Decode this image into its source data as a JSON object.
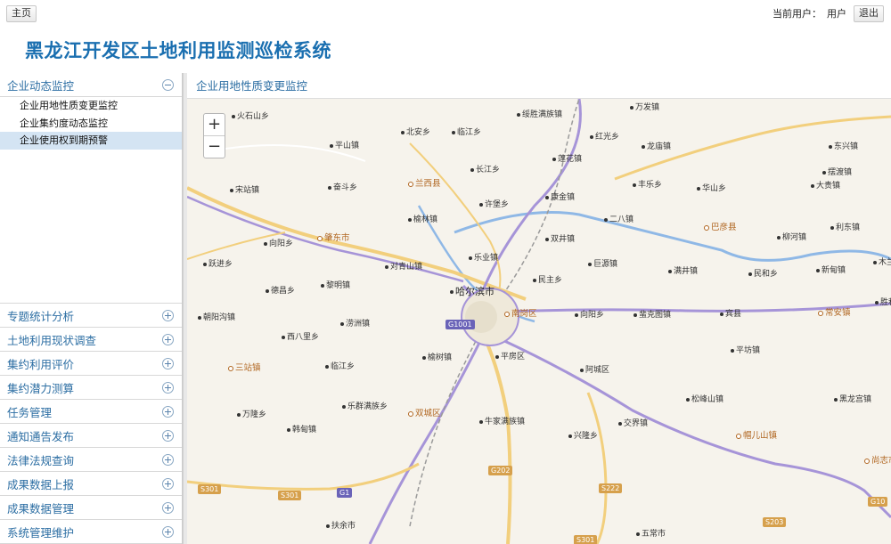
{
  "header": {
    "home_label": "主页",
    "current_user_label": "当前用户：",
    "user_name": "用户",
    "logout_label": "退出"
  },
  "app_title": "黑龙江开发区土地利用监测巡检系统",
  "sidebar": {
    "open_section": {
      "label": "企业动态监控",
      "items": [
        {
          "label": "企业用地性质变更监控"
        },
        {
          "label": "企业集约度动态监控"
        },
        {
          "label": "企业使用权到期预警"
        }
      ]
    },
    "sections": [
      {
        "label": "专题统计分析"
      },
      {
        "label": "土地利用现状调查"
      },
      {
        "label": "集约利用评价"
      },
      {
        "label": "集约潜力测算"
      },
      {
        "label": "任务管理"
      },
      {
        "label": "通知通告发布"
      },
      {
        "label": "法律法规查询"
      },
      {
        "label": "成果数据上报"
      },
      {
        "label": "成果数据管理"
      },
      {
        "label": "系统管理维护"
      }
    ]
  },
  "panel": {
    "title": "企业用地性质变更监控"
  },
  "map": {
    "zoom_in": "+",
    "zoom_out": "−",
    "places": [
      "火石山乡",
      "北安乡",
      "临江乡",
      "绥胜满族镇",
      "万发镇",
      "平山镇",
      "红光乡",
      "龙庙镇",
      "东兴镇",
      "莲花镇",
      "长江乡",
      "兰西县",
      "丰乐乡",
      "摆渡镇",
      "宋站镇",
      "奋斗乡",
      "康金镇",
      "华山乡",
      "大贵镇",
      "许堡乡",
      "二八镇",
      "巴彦县",
      "柳河镇",
      "榆林镇",
      "双井镇",
      "利东镇",
      "向阳乡",
      "肇东市",
      "乐业镇",
      "巨源镇",
      "满井镇",
      "民和乡",
      "新甸镇",
      "木兰",
      "跃进乡",
      "对青山镇",
      "民主乡",
      "德昌乡",
      "黎明镇",
      "哈尔滨市",
      "南岗区",
      "向阳乡",
      "蜚克图镇",
      "宾县",
      "常安镇",
      "胜利",
      "朝阳沟镇",
      "涝洲镇",
      "西八里乡",
      "平坊镇",
      "临江乡",
      "榆树镇",
      "平房区",
      "阿城区",
      "三站镇",
      "松峰山镇",
      "黑龙宫镇",
      "乐群满族乡",
      "双城区",
      "万隆乡",
      "牛家满族镇",
      "交界镇",
      "韩甸镇",
      "兴隆乡",
      "帽儿山镇",
      "尚志市",
      "扶余市",
      "五常市"
    ],
    "road_shields": [
      "G1001",
      "G202",
      "G1",
      "S301",
      "S301",
      "S222",
      "S203",
      "G10",
      "S301"
    ]
  },
  "colors": {
    "accent": "#1a6fb0",
    "section_text": "#2c6ea3",
    "active_item_bg": "#d4e4f3"
  }
}
